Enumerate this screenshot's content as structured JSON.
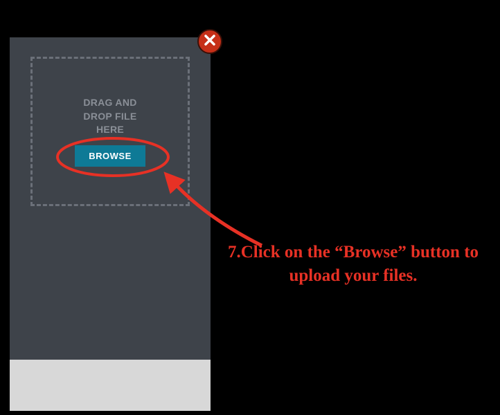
{
  "modal": {
    "dropzone_text": "DRAG AND\nDROP FILE\nHERE",
    "browse_label": "BROWSE"
  },
  "annotation": {
    "text": "7.Click on the “Browse” button to upload your files.",
    "color": "#e73125"
  },
  "colors": {
    "panel_bg": "#3e434a",
    "panel_outer": "#d8d8d8",
    "browse_bg": "#0e7a96",
    "close_bg": "#c62f18"
  }
}
